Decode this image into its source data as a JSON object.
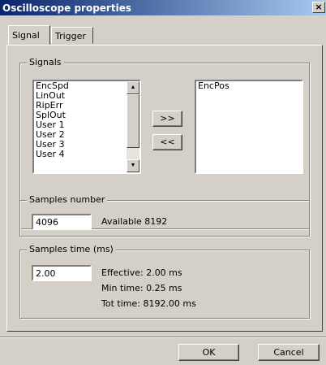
{
  "window": {
    "title": "Oscilloscope properties",
    "close_glyph": "×"
  },
  "tabs": [
    {
      "label": "Signal",
      "active": true
    },
    {
      "label": "Trigger",
      "active": false
    }
  ],
  "signals": {
    "legend": "Signals",
    "available": [
      "EncSpd",
      "LinOut",
      "RipErr",
      "SplOut",
      "User 1",
      "User 2",
      "User 3",
      "User 4"
    ],
    "selected": [
      "EncPos"
    ],
    "add_button": ">>",
    "remove_button": "<<"
  },
  "samples_number": {
    "legend": "Samples number",
    "value": "4096",
    "available_text": "Available 8192"
  },
  "samples_time": {
    "legend": "Samples time (ms)",
    "value": "2.00",
    "effective": "Effective: 2.00 ms",
    "min_time": "Min time: 0.25 ms",
    "tot_time": "Tot time: 8192.00 ms"
  },
  "buttons": {
    "ok": "OK",
    "cancel": "Cancel"
  },
  "icons": {
    "scroll_up": "scroll-up-arrow-icon",
    "scroll_down": "scroll-down-arrow-icon",
    "close": "close-icon"
  }
}
